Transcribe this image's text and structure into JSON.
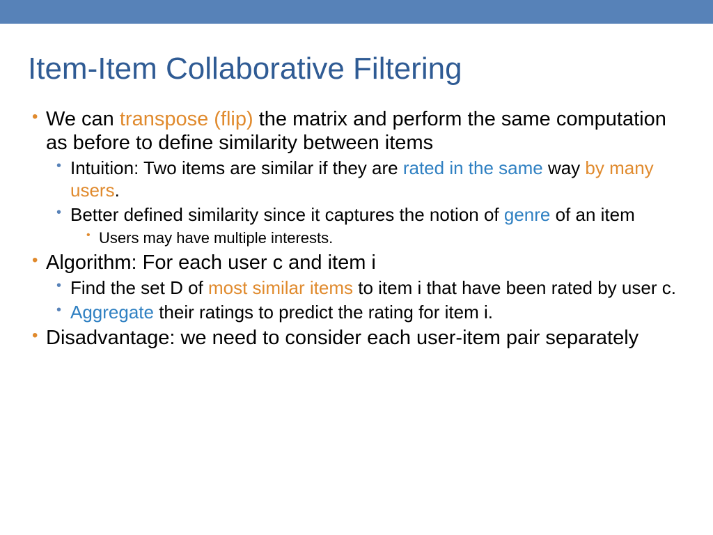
{
  "title": "Item-Item Collaborative Filtering",
  "bullets": {
    "b1": {
      "t1": "We can ",
      "t2": "transpose (flip)",
      "t3": " the matrix and perform the same computation as before to define similarity between items"
    },
    "b1a": {
      "t1": "Intuition: Two items are similar if they are ",
      "t2": "rated in the same",
      "t3": " way ",
      "t4": "by many users",
      "t5": "."
    },
    "b1b": {
      "t1": "Better defined similarity since it captures the notion of ",
      "t2": "genre",
      "t3": " of an item"
    },
    "b1b1": {
      "t1": "Users may have multiple interests."
    },
    "b2": {
      "t1": "Algorithm: For each user c and item i"
    },
    "b2a": {
      "t1": "Find the set D of ",
      "t2": "most similar items",
      "t3": " to item i that have been rated by user c."
    },
    "b2b": {
      "t1": "Aggregate",
      "t2": " their ratings to predict the rating for item i."
    },
    "b3": {
      "t1": "Disadvantage: we need to consider each user-item pair separately"
    }
  }
}
